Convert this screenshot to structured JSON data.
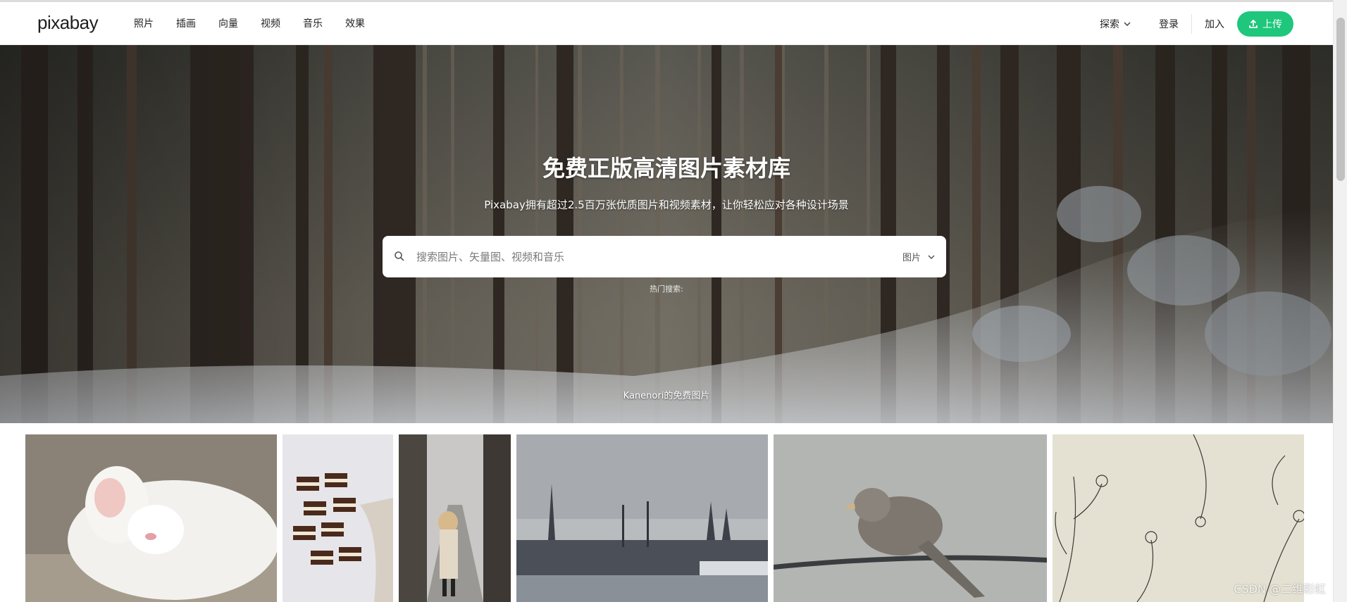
{
  "header": {
    "logo": "pixabay",
    "nav": [
      "照片",
      "插画",
      "向量",
      "视频",
      "音乐",
      "效果"
    ],
    "explore_label": "探索",
    "login_label": "登录",
    "join_label": "加入",
    "upload_label": "上传",
    "accent_color": "#1ec77b"
  },
  "hero": {
    "title": "免费正版高清图片素材库",
    "subtitle": "Pixabay拥有超过2.5百万张优质图片和视频素材，让你轻松应对各种设计场景",
    "search": {
      "placeholder": "搜索图片、矢量图、视频和音乐",
      "value": "",
      "type_selected": "图片"
    },
    "hot_search_label": "热门搜索:",
    "credit": "Kanenori的免费图片"
  },
  "gallery": {
    "tiles": [
      {
        "subject": "white cat sleeping"
      },
      {
        "subject": "chocolate layered cake bars"
      },
      {
        "subject": "woman in coat on street"
      },
      {
        "subject": "city skyline with church spires"
      },
      {
        "subject": "bird perched on wire"
      },
      {
        "subject": "floral line drawing pattern"
      }
    ]
  },
  "watermark": "CSDN @二维彩虹"
}
